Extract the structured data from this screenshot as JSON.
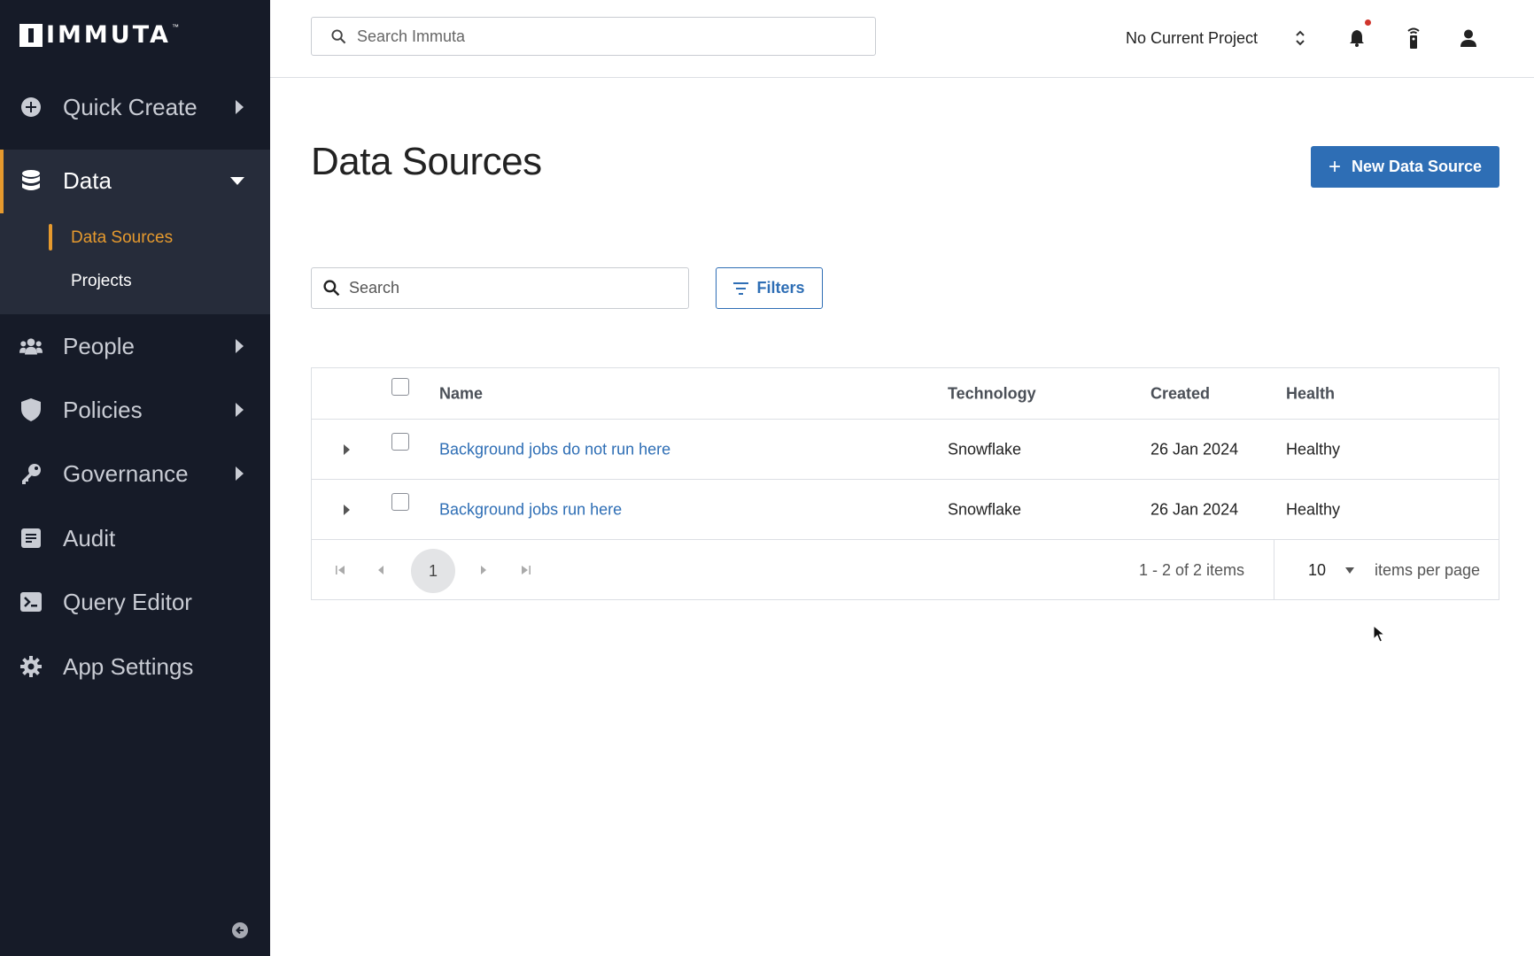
{
  "brand": {
    "logo_text": "IMMUTA",
    "logo_tm": "™"
  },
  "sidebar": {
    "items": [
      {
        "label": "Quick Create",
        "icon": "plus-circle-icon"
      },
      {
        "label": "Data",
        "icon": "database-icon"
      },
      {
        "label": "People",
        "icon": "people-icon"
      },
      {
        "label": "Policies",
        "icon": "shield-icon"
      },
      {
        "label": "Governance",
        "icon": "key-icon"
      },
      {
        "label": "Audit",
        "icon": "audit-icon"
      },
      {
        "label": "Query Editor",
        "icon": "terminal-icon"
      },
      {
        "label": "App Settings",
        "icon": "gear-icon"
      }
    ],
    "data_sub": [
      {
        "label": "Data Sources",
        "active": true
      },
      {
        "label": "Projects",
        "active": false
      }
    ]
  },
  "topbar": {
    "search_placeholder": "Search Immuta",
    "project": "No Current Project"
  },
  "main": {
    "title": "Data Sources",
    "new_button": "New Data Source",
    "search_placeholder": "Search",
    "filters_label": "Filters"
  },
  "table": {
    "columns": [
      "Name",
      "Technology",
      "Created",
      "Health"
    ],
    "rows": [
      {
        "name": "Background jobs do not run here",
        "technology": "Snowflake",
        "created": "26 Jan 2024",
        "health": "Healthy"
      },
      {
        "name": "Background jobs run here",
        "technology": "Snowflake",
        "created": "26 Jan 2024",
        "health": "Healthy"
      }
    ]
  },
  "pager": {
    "current_page": "1",
    "info": "1 - 2 of 2 items",
    "per_page": "10",
    "per_page_label": "items per page"
  },
  "colors": {
    "sidebar_bg": "#161b28",
    "sidebar_active_bg": "#262c3a",
    "accent_orange": "#e69a2e",
    "primary_blue": "#2e6eb5",
    "notification_dot": "#d0342c"
  }
}
